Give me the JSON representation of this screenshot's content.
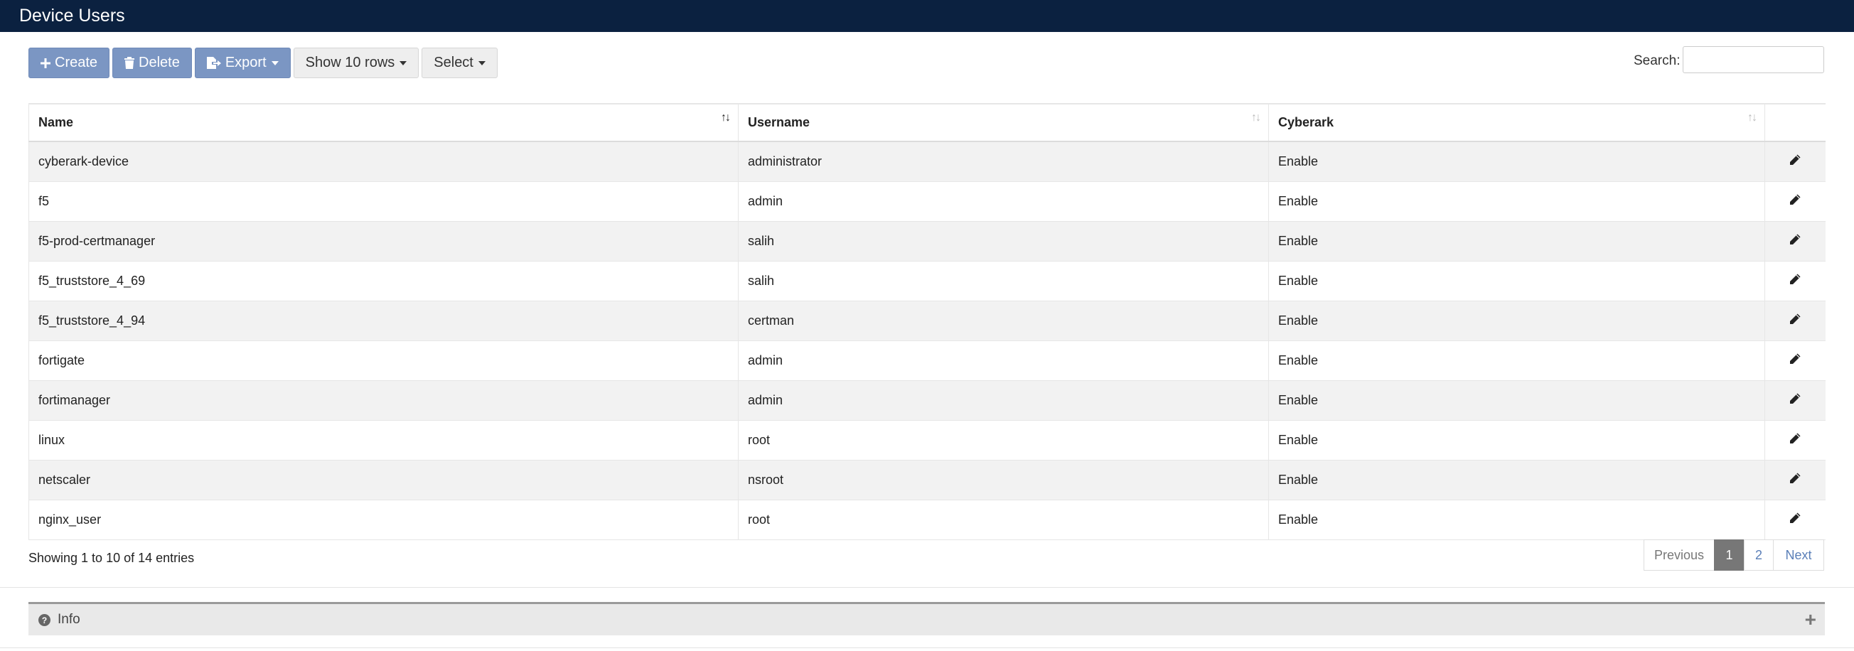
{
  "header": {
    "title": "Device Users"
  },
  "toolbar": {
    "create_label": "Create",
    "delete_label": "Delete",
    "export_label": "Export",
    "rows_label": "Show 10 rows",
    "select_label": "Select"
  },
  "search": {
    "label": "Search:",
    "value": ""
  },
  "table": {
    "columns": [
      "Name",
      "Username",
      "Cyberark"
    ],
    "rows": [
      {
        "name": "cyberark-device",
        "username": "administrator",
        "cyberark": "Enable"
      },
      {
        "name": "f5",
        "username": "admin",
        "cyberark": "Enable"
      },
      {
        "name": "f5-prod-certmanager",
        "username": "salih",
        "cyberark": "Enable"
      },
      {
        "name": "f5_truststore_4_69",
        "username": "salih",
        "cyberark": "Enable"
      },
      {
        "name": "f5_truststore_4_94",
        "username": "certman",
        "cyberark": "Enable"
      },
      {
        "name": "fortigate",
        "username": "admin",
        "cyberark": "Enable"
      },
      {
        "name": "fortimanager",
        "username": "admin",
        "cyberark": "Enable"
      },
      {
        "name": "linux",
        "username": "root",
        "cyberark": "Enable"
      },
      {
        "name": "netscaler",
        "username": "nsroot",
        "cyberark": "Enable"
      },
      {
        "name": "nginx_user",
        "username": "root",
        "cyberark": "Enable"
      }
    ]
  },
  "footer": {
    "info": "Showing 1 to 10 of 14 entries"
  },
  "pagination": {
    "previous": "Previous",
    "page1": "1",
    "page2": "2",
    "next": "Next"
  },
  "info_panel": {
    "label": "Info"
  },
  "colors": {
    "header_bg": "#0b2140",
    "button_blue": "#7b96c3",
    "active_page": "#777777",
    "link": "#5a7fb8"
  },
  "icons": [
    "plus-icon",
    "trash-icon",
    "export-icon",
    "sort-icon",
    "pencil-icon",
    "question-circle-icon",
    "expand-plus-icon"
  ]
}
